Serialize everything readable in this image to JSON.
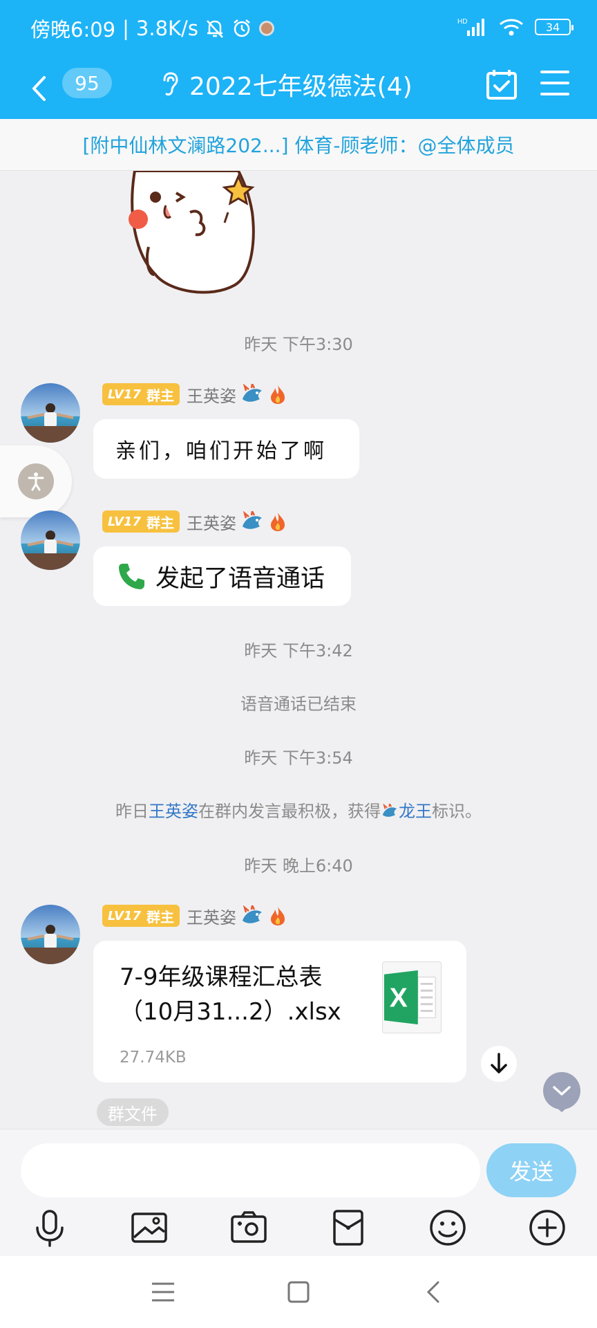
{
  "status_bar": {
    "time": "傍晚6:09",
    "speed": "3.8K/s",
    "battery": "34",
    "signal": "HD"
  },
  "header": {
    "unread_count": "95",
    "title": "2022七年级德法(4)"
  },
  "notice": {
    "text": "[附中仙林文澜路202...] 体育-顾老师：@全体成员"
  },
  "timestamps": [
    "昨天 下午3:30",
    "昨天 下午3:42",
    "昨天 下午3:54",
    "昨天 晚上6:40"
  ],
  "system_messages": {
    "call_ended": "语音通话已结束",
    "badge_pre": "昨日",
    "badge_name": "王英姿",
    "badge_mid": "在群内发言最积极，获得",
    "badge_title": "龙王",
    "badge_post": "标识。"
  },
  "sender": {
    "level": "LV17",
    "role": "群主",
    "name": "王英姿"
  },
  "messages": {
    "text": "亲们，咱们开始了啊",
    "call": "发起了语音通话",
    "file_name": "7-9年级课程汇总表（10月31...2）.xlsx",
    "file_size": "27.74KB",
    "file_tag": "群文件"
  },
  "input": {
    "placeholder": "",
    "send_label": "发送"
  },
  "icons": [
    "back-icon",
    "earpiece-icon",
    "calendar-check-icon",
    "menu-icon",
    "accessibility-icon",
    "phone-icon",
    "excel-icon",
    "download-icon",
    "scroll-down-icon",
    "microphone-icon",
    "image-icon",
    "camera-icon",
    "red-packet-icon",
    "emoji-icon",
    "plus-icon"
  ],
  "colors": {
    "header": "#1db3f7",
    "notice_text": "#22a3dc",
    "send_button": "#8ed2f6",
    "level_badge": "#f7c13f",
    "highlight": "#3478c6"
  }
}
